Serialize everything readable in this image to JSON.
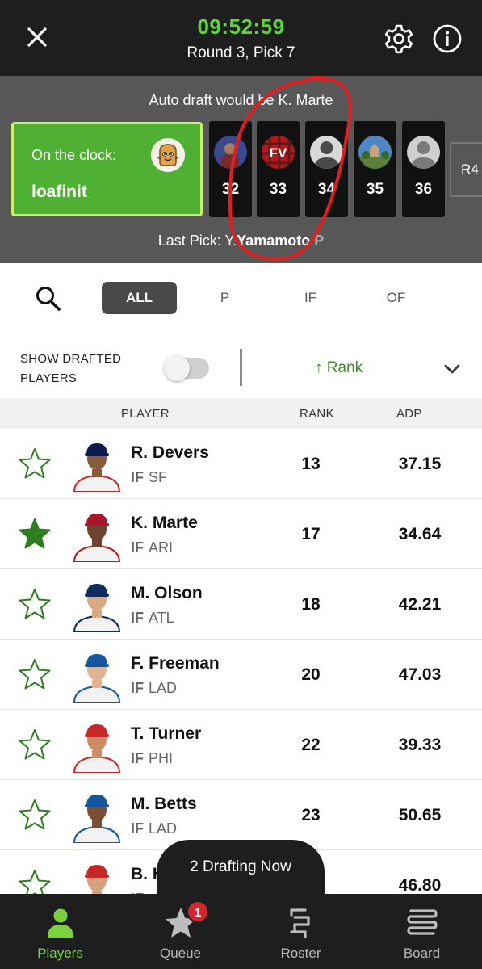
{
  "header": {
    "timer": "09:52:59",
    "round_pick": "Round 3, Pick 7"
  },
  "draft_bar": {
    "auto_draft_text": "Auto draft would be K. Marte",
    "on_clock_label": "On the clock:",
    "on_clock_user": "loafinit",
    "picks": [
      {
        "number": "32"
      },
      {
        "number": "33",
        "avatar_text": "FV"
      },
      {
        "number": "34"
      },
      {
        "number": "35"
      },
      {
        "number": "36"
      }
    ],
    "next_round_tab": "R4",
    "last_pick_label": "Last Pick:",
    "last_pick_initial": "Y.",
    "last_pick_name": "Yamamoto",
    "last_pick_pos": "P"
  },
  "filters": {
    "tabs": [
      "ALL",
      "P",
      "IF",
      "OF"
    ],
    "active": "ALL"
  },
  "toggle_row": {
    "show_drafted_label": "SHOW DRAFTED PLAYERS",
    "show_drafted_on": false,
    "sort_label": "↑ Rank"
  },
  "table": {
    "headers": {
      "player": "PLAYER",
      "rank": "RANK",
      "adp": "ADP"
    },
    "rows": [
      {
        "name": "R. Devers",
        "pos": "IF",
        "team": "SF",
        "rank": "13",
        "adp": "37.15",
        "starred": false
      },
      {
        "name": "K. Marte",
        "pos": "IF",
        "team": "ARI",
        "rank": "17",
        "adp": "34.64",
        "starred": true
      },
      {
        "name": "M. Olson",
        "pos": "IF",
        "team": "ATL",
        "rank": "18",
        "adp": "42.21",
        "starred": false
      },
      {
        "name": "F. Freeman",
        "pos": "IF",
        "team": "LAD",
        "rank": "20",
        "adp": "47.03",
        "starred": false
      },
      {
        "name": "T. Turner",
        "pos": "IF",
        "team": "PHI",
        "rank": "22",
        "adp": "39.33",
        "starred": false
      },
      {
        "name": "M. Betts",
        "pos": "IF",
        "team": "LAD",
        "rank": "23",
        "adp": "50.65",
        "starred": false
      },
      {
        "name": "B. H",
        "pos": "IF",
        "team": "",
        "rank": "",
        "adp": "46.80",
        "starred": false
      }
    ]
  },
  "drafting_now": "2 Drafting Now",
  "nav": {
    "items": [
      {
        "label": "Players",
        "icon": "person-icon"
      },
      {
        "label": "Queue",
        "icon": "star-icon",
        "badge": "1"
      },
      {
        "label": "Roster",
        "icon": "roster-icon"
      },
      {
        "label": "Board",
        "icon": "board-icon"
      }
    ],
    "active": "Players"
  },
  "colors": {
    "accent_green": "#5fd33c",
    "clock_green": "#4fb033",
    "star_green": "#2e7d1e",
    "badge_red": "#d1262e",
    "annotation_red": "#e02020"
  }
}
